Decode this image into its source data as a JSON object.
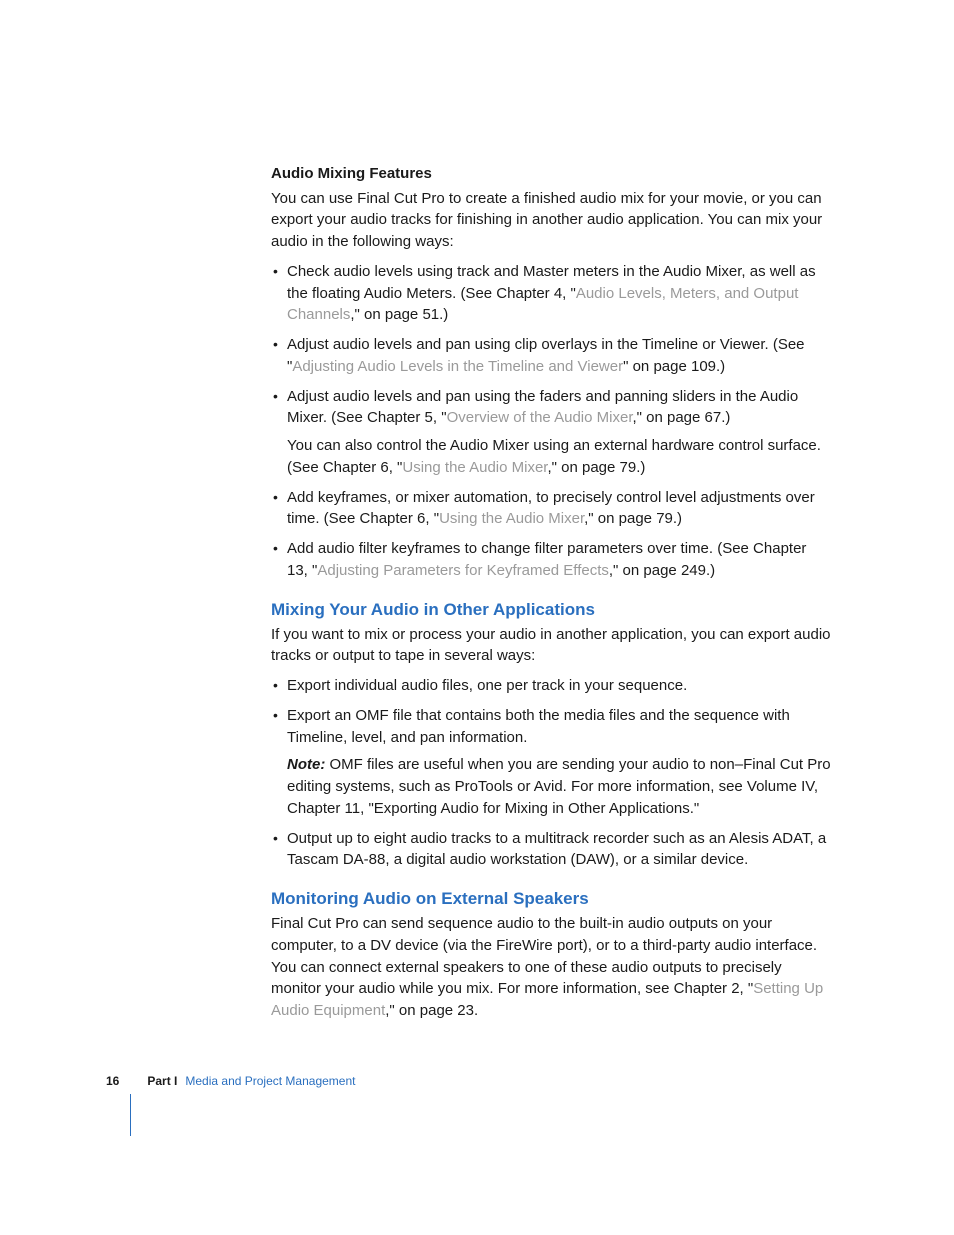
{
  "section1": {
    "head": "Audio Mixing Features",
    "intro": "You can use Final Cut Pro to create a finished audio mix for your movie, or you can export your audio tracks for finishing in another audio application. You can mix your audio in the following ways:",
    "b1_a": "Check audio levels using track and Master meters in the Audio Mixer, as well as the floating Audio Meters. (See Chapter 4, \"",
    "b1_link": "Audio Levels, Meters, and Output Channels",
    "b1_b": ",\" on page 51.)",
    "b2_a": "Adjust audio levels and pan using clip overlays in the Timeline or Viewer. (See \"",
    "b2_link": "Adjusting Audio Levels in the Timeline and Viewer",
    "b2_b": "\" on page 109.)",
    "b3_a": "Adjust audio levels and pan using the faders and panning sliders in the Audio Mixer. (See Chapter 5, \"",
    "b3_link": "Overview of the Audio Mixer",
    "b3_b": ",\" on page 67.)",
    "b3_sub_a": "You can also control the Audio Mixer using an external hardware control surface. (See Chapter 6, \"",
    "b3_sub_link": "Using the Audio Mixer",
    "b3_sub_b": ",\" on page 79.)",
    "b4_a": "Add keyframes, or mixer automation, to precisely control level adjustments over time. (See Chapter 6, \"",
    "b4_link": "Using the Audio Mixer",
    "b4_b": ",\" on page 79.)",
    "b5_a": "Add audio filter keyframes to change filter parameters over time. (See Chapter 13, \"",
    "b5_link": "Adjusting Parameters for Keyframed Effects",
    "b5_b": ",\" on page 249.)"
  },
  "section2": {
    "head": "Mixing Your Audio in Other Applications",
    "intro": "If you want to mix or process your audio in another application, you can export audio tracks or output to tape in several ways:",
    "b1": "Export individual audio files, one per track in your sequence.",
    "b2": "Export an OMF file that contains both the media files and the sequence with Timeline, level, and pan information.",
    "note_label": "Note:  ",
    "note_body": "OMF files are useful when you are sending your audio to non–Final Cut Pro editing systems, such as ProTools or Avid. For more information, see Volume IV, Chapter 11, \"Exporting Audio for Mixing in Other Applications.\"",
    "b3": "Output up to eight audio tracks to a multitrack recorder such as an Alesis ADAT, a Tascam DA-88, a digital audio workstation (DAW), or a similar device."
  },
  "section3": {
    "head": "Monitoring Audio on External Speakers",
    "body_a": "Final Cut Pro can send sequence audio to the built-in audio outputs on your computer, to a DV device (via the FireWire port), or to a third-party audio interface. You can connect external speakers to one of these audio outputs to precisely monitor your audio while you mix. For more information, see Chapter 2, \"",
    "body_link": "Setting Up Audio Equipment",
    "body_b": ",\" on page 23."
  },
  "footer": {
    "page": "16",
    "part": "Part I",
    "title": "Media and Project Management"
  }
}
